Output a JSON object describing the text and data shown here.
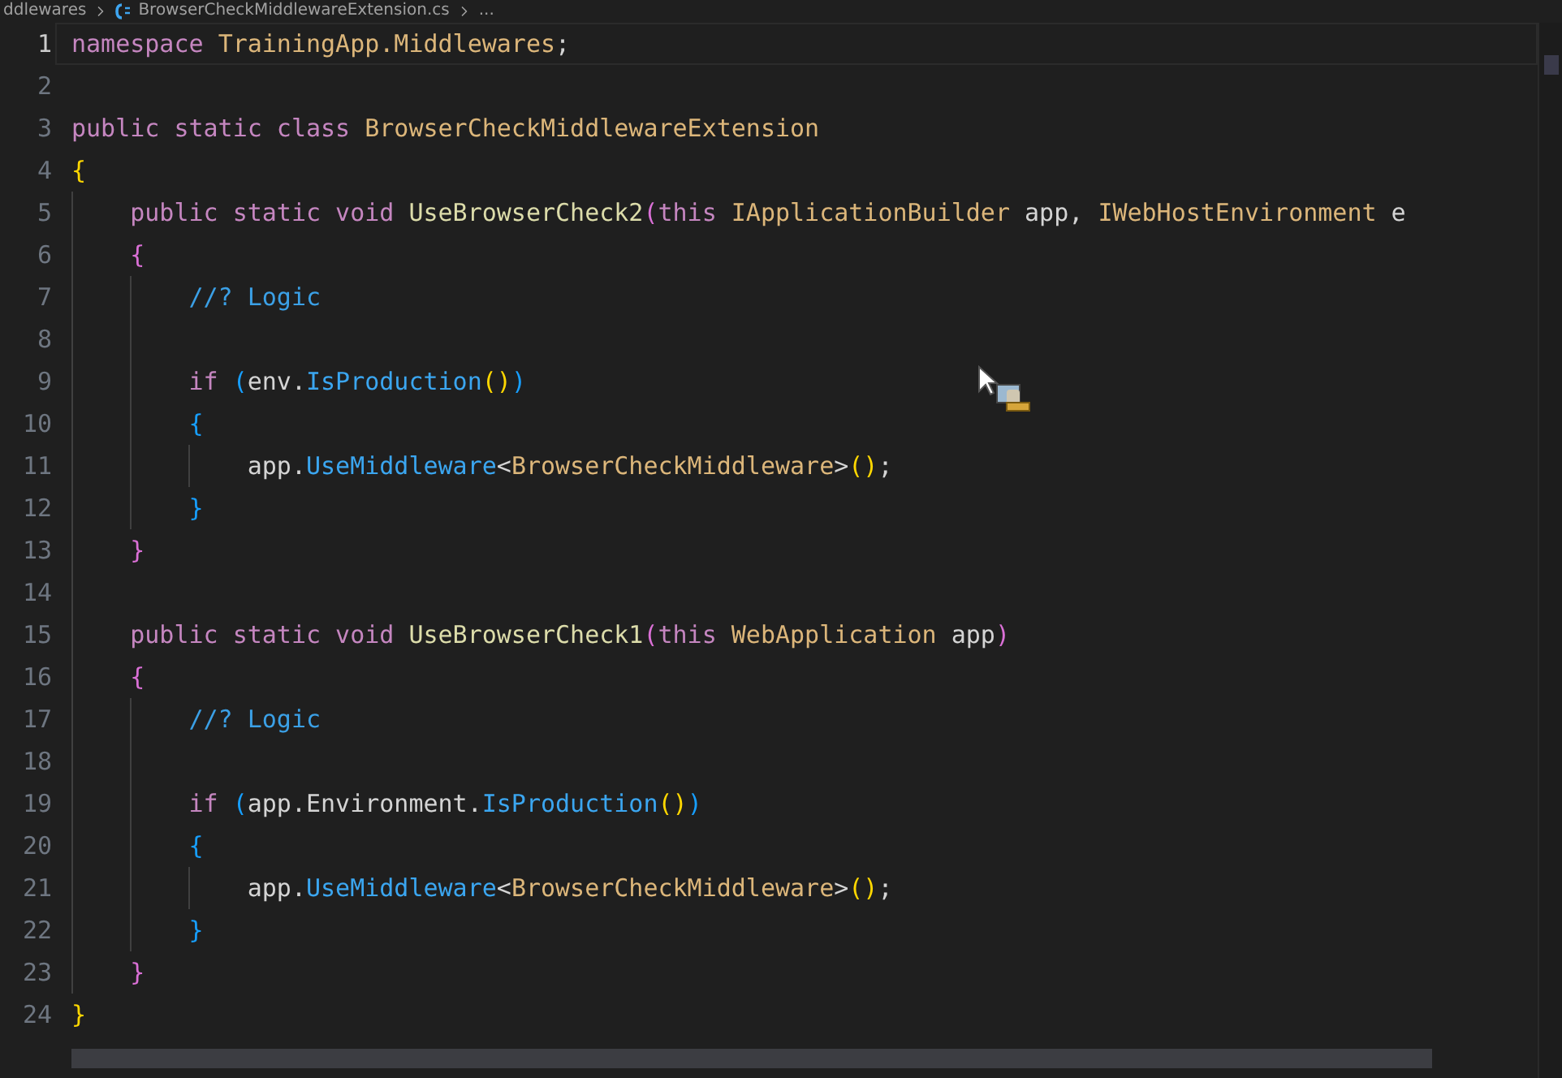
{
  "breadcrumb": {
    "items": [
      "ddlewares",
      "BrowserCheckMiddlewareExtension.cs",
      "..."
    ]
  },
  "editor": {
    "lines": [
      {
        "number": "1",
        "active": true,
        "tokens": [
          {
            "text": "namespace ",
            "kind": "keyword"
          },
          {
            "text": "TrainingApp.Middlewares",
            "kind": "type"
          },
          {
            "text": ";",
            "kind": "plain"
          }
        ]
      },
      {
        "number": "2",
        "active": false
      },
      {
        "number": "3",
        "active": false,
        "tokens": [
          {
            "text": "public static class ",
            "kind": "keyword"
          },
          {
            "text": "BrowserCheckMiddlewareExtension",
            "kind": "type"
          }
        ]
      },
      {
        "number": "4",
        "active": false,
        "tokens": [
          {
            "text": "{",
            "kind": "bracket1"
          }
        ]
      },
      {
        "number": "5",
        "active": false,
        "tokens": [
          {
            "text": "    public static void ",
            "kind": "keyword"
          },
          {
            "text": "UseBrowserCheck2",
            "kind": "method"
          },
          {
            "text": "(",
            "kind": "bracket2"
          },
          {
            "text": "this ",
            "kind": "keyword"
          },
          {
            "text": "IApplicationBuilder",
            "kind": "type"
          },
          {
            "text": " app, ",
            "kind": "plain"
          },
          {
            "text": "IWebHostEnvironment",
            "kind": "type"
          },
          {
            "text": " e",
            "kind": "plain"
          }
        ]
      },
      {
        "number": "6",
        "active": false,
        "tokens": [
          {
            "text": "    {",
            "kind": "bracket2"
          }
        ]
      },
      {
        "number": "7",
        "active": false,
        "tokens": [
          {
            "text": "        //? Logic",
            "kind": "comment"
          }
        ]
      },
      {
        "number": "8",
        "active": false
      },
      {
        "number": "9",
        "active": false,
        "tokens": [
          {
            "text": "        if ",
            "kind": "keyword"
          },
          {
            "text": "(",
            "kind": "bracket3"
          },
          {
            "text": "env.",
            "kind": "plain"
          },
          {
            "text": "IsProduction",
            "kind": "call"
          },
          {
            "text": "()",
            "kind": "bracket1"
          },
          {
            "text": ")",
            "kind": "bracket3"
          }
        ]
      },
      {
        "number": "10",
        "active": false,
        "tokens": [
          {
            "text": "        {",
            "kind": "bracket3"
          }
        ]
      },
      {
        "number": "11",
        "active": false,
        "tokens": [
          {
            "text": "            app.",
            "kind": "plain"
          },
          {
            "text": "UseMiddleware",
            "kind": "call"
          },
          {
            "text": "<",
            "kind": "plain"
          },
          {
            "text": "BrowserCheckMiddleware",
            "kind": "type"
          },
          {
            "text": ">",
            "kind": "plain"
          },
          {
            "text": "()",
            "kind": "bracket1"
          },
          {
            "text": ";",
            "kind": "plain"
          }
        ]
      },
      {
        "number": "12",
        "active": false,
        "tokens": [
          {
            "text": "        }",
            "kind": "bracket3"
          }
        ]
      },
      {
        "number": "13",
        "active": false,
        "tokens": [
          {
            "text": "    }",
            "kind": "bracket2"
          }
        ]
      },
      {
        "number": "14",
        "active": false
      },
      {
        "number": "15",
        "active": false,
        "tokens": [
          {
            "text": "    public static void ",
            "kind": "keyword"
          },
          {
            "text": "UseBrowserCheck1",
            "kind": "method"
          },
          {
            "text": "(",
            "kind": "bracket2"
          },
          {
            "text": "this ",
            "kind": "keyword"
          },
          {
            "text": "WebApplication",
            "kind": "type"
          },
          {
            "text": " app",
            "kind": "plain"
          },
          {
            "text": ")",
            "kind": "bracket2"
          }
        ]
      },
      {
        "number": "16",
        "active": false,
        "tokens": [
          {
            "text": "    {",
            "kind": "bracket2"
          }
        ]
      },
      {
        "number": "17",
        "active": false,
        "tokens": [
          {
            "text": "        //? Logic",
            "kind": "comment"
          }
        ]
      },
      {
        "number": "18",
        "active": false
      },
      {
        "number": "19",
        "active": false,
        "tokens": [
          {
            "text": "        if ",
            "kind": "keyword"
          },
          {
            "text": "(",
            "kind": "bracket3"
          },
          {
            "text": "app.Environment.",
            "kind": "plain"
          },
          {
            "text": "IsProduction",
            "kind": "call"
          },
          {
            "text": "()",
            "kind": "bracket1"
          },
          {
            "text": ")",
            "kind": "bracket3"
          }
        ]
      },
      {
        "number": "20",
        "active": false,
        "tokens": [
          {
            "text": "        {",
            "kind": "bracket3"
          }
        ]
      },
      {
        "number": "21",
        "active": false,
        "tokens": [
          {
            "text": "            app.",
            "kind": "plain"
          },
          {
            "text": "UseMiddleware",
            "kind": "call"
          },
          {
            "text": "<",
            "kind": "plain"
          },
          {
            "text": "BrowserCheckMiddleware",
            "kind": "type"
          },
          {
            "text": ">",
            "kind": "plain"
          },
          {
            "text": "()",
            "kind": "bracket1"
          },
          {
            "text": ";",
            "kind": "plain"
          }
        ]
      },
      {
        "number": "22",
        "active": false,
        "tokens": [
          {
            "text": "        }",
            "kind": "bracket3"
          }
        ]
      },
      {
        "number": "23",
        "active": false,
        "tokens": [
          {
            "text": "    }",
            "kind": "bracket2"
          }
        ]
      },
      {
        "number": "24",
        "active": false,
        "tokens": [
          {
            "text": "}",
            "kind": "bracket1"
          }
        ]
      }
    ]
  }
}
